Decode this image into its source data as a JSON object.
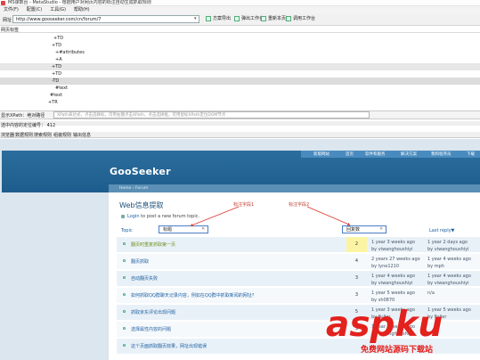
{
  "window": {
    "title": "MS谋数台 - MetaStudio - 根据用户对网页内容的标注自动生成抓取规则"
  },
  "menu": [
    "文件(F)",
    "配置(C)",
    "工具(G)",
    "帮助(H)"
  ],
  "toolbar": {
    "url_label": "网址",
    "url_value": "http://www.gooseeker.com/cn/forum/7",
    "buttons": [
      "刷新",
      "弹出工作台",
      "重新本页面",
      "调用工作台"
    ],
    "checkbox_label": "方案导出"
  },
  "dom_panel": {
    "title": "网页标签",
    "nodes": [
      "TD",
      "TD",
      "#attributes",
      "A",
      "TD",
      "TD",
      "TD",
      "#text",
      "#text",
      "TR"
    ]
  },
  "xpath": {
    "label": "显示XPath：绝对路径",
    "placeholder": "XPath表达式，点击选择标，可用右键点击XPath，点击选择框，可用鼠标XPath定位DOM节点"
  },
  "count": {
    "label": "选中内容的定位编号：",
    "value": "412"
  },
  "tabs": [
    "浏览器",
    "数据规则",
    "搜索规则",
    "组装规则",
    "输出信息"
  ],
  "site": {
    "logo": "GooSeeker",
    "nav": [
      "新版网站",
      "首页",
      "软件和服务",
      "解决方案",
      "我和程序员",
      "下载"
    ],
    "breadcrumb": "Home › Forum",
    "forum_title": "Web信息提取",
    "login_link": "Login",
    "login_text": " to post a new forum topic.",
    "columns": {
      "topic": "Topic",
      "replies": "",
      "last_reply": "Last reply▼"
    },
    "field1_input": "标题",
    "field2_input": "回复数",
    "annotation1": "标注字段1",
    "annotation2": "标注字段2",
    "rows": [
      {
        "topic": "翻页时重复抓取第一页",
        "replies": "2",
        "last_reply": [
          "1 year 3 weeks ago",
          "by viwanghoushiyi"
        ],
        "last_post": [
          "1 year 2 days ago",
          "by viwanghoushiyi"
        ],
        "highlight": true
      },
      {
        "topic": "翻页抓取",
        "replies": "4",
        "last_reply": [
          "2 years 27 weeks ago",
          "by lyne1210"
        ],
        "last_post": [
          "1 year 4 weeks ago",
          "by mph"
        ],
        "highlight": false
      },
      {
        "topic": "自动翻页失败",
        "replies": "3",
        "last_reply": [
          "1 year 4 weeks ago",
          "by viwanghoushiyi"
        ],
        "last_post": [
          "1 year 4 weeks ago",
          "by viwanghoushiyi"
        ],
        "highlight": false
      },
      {
        "topic": "如何抓取QQ群聊天记录内容，例如在QQ群中抓取新闻的网址？",
        "replies": "3",
        "last_reply": [
          "1 year 5 weeks ago",
          "by sh0870"
        ],
        "last_post": [
          "n/a",
          ""
        ],
        "highlight": false
      },
      {
        "topic": "抓取京东评论出现问题",
        "replies": "5",
        "last_reply": [
          "1 year 3 weeks ago",
          "by Fuller"
        ],
        "last_post": [
          "1 year 5 weeks ago",
          "by Fuller"
        ],
        "highlight": false
      },
      {
        "topic": "选择属性内容的问题",
        "replies": "3",
        "last_reply": [
          "1 year 5 weeks ago",
          "by viwanghoushiyi"
        ],
        "last_post": [
          "",
          ""
        ],
        "highlight": false
      },
      {
        "topic": "这个页面抓取翻页效果，网址出现错误",
        "replies": "",
        "last_reply": [
          "",
          ""
        ],
        "last_post": [
          "",
          ""
        ],
        "highlight": false
      }
    ]
  },
  "watermark": {
    "main": "aspku",
    "sub": "免费网站源码下载站"
  }
}
